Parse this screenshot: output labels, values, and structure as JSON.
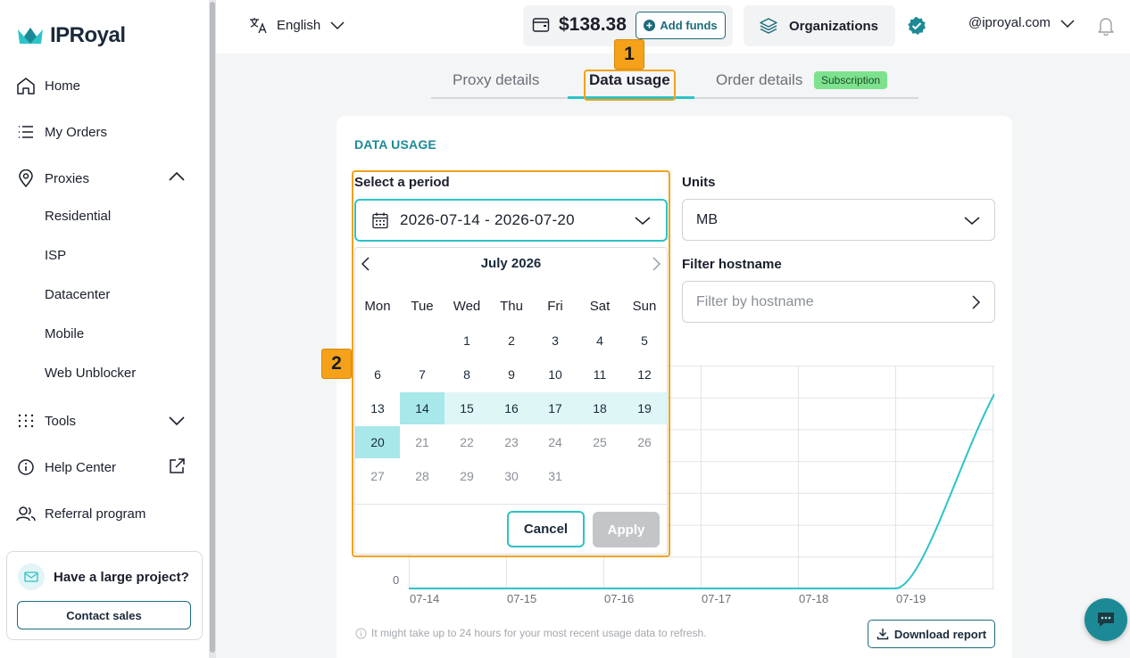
{
  "brand": {
    "name": "IPRoyal",
    "accent": "#2cc3c7",
    "dark_accent": "#1c6b7a"
  },
  "sidebar": {
    "items": [
      {
        "label": "Home",
        "icon": "home-icon"
      },
      {
        "label": "My Orders",
        "icon": "list-icon"
      },
      {
        "label": "Proxies",
        "icon": "location-pin-icon"
      },
      {
        "label": "Tools",
        "icon": "grid-dots-icon"
      },
      {
        "label": "Help Center",
        "icon": "info-icon"
      },
      {
        "label": "Referral program",
        "icon": "users-icon"
      }
    ],
    "proxies_sub": [
      "Residential",
      "ISP",
      "Datacenter",
      "Mobile",
      "Web Unblocker"
    ],
    "promo": {
      "title": "Have a large project?",
      "button": "Contact sales"
    }
  },
  "topbar": {
    "language": "English",
    "balance": "$138.38",
    "add_funds": "Add funds",
    "organizations": "Organizations",
    "account": "@iproyal.com"
  },
  "tabs": [
    {
      "label": "Proxy details",
      "active": false
    },
    {
      "label": "Data usage",
      "active": true
    },
    {
      "label": "Order details",
      "active": false,
      "badge": "Subscription"
    }
  ],
  "data_usage": {
    "title": "DATA USAGE",
    "period_label": "Select a period",
    "period_value": "2026-07-14 - 2026-07-20",
    "units_label": "Units",
    "units_value": "MB",
    "filter_label": "Filter hostname",
    "filter_placeholder": "Filter by hostname",
    "note": "It might take up to 24 hours for your most recent usage data to refresh.",
    "download": "Download report"
  },
  "calendar": {
    "month": "July 2026",
    "weekdays": [
      "Mon",
      "Tue",
      "Wed",
      "Thu",
      "Fri",
      "Sat",
      "Sun"
    ],
    "weeks": [
      [
        "",
        "",
        "1",
        "2",
        "3",
        "4",
        "5"
      ],
      [
        "6",
        "7",
        "8",
        "9",
        "10",
        "11",
        "12"
      ],
      [
        "13",
        "14",
        "15",
        "16",
        "17",
        "18",
        "19"
      ],
      [
        "20",
        "21",
        "22",
        "23",
        "24",
        "25",
        "26"
      ],
      [
        "27",
        "28",
        "29",
        "30",
        "31",
        "",
        ""
      ]
    ],
    "selected_start": "14",
    "selected_end": "20",
    "cancel": "Cancel",
    "apply": "Apply"
  },
  "chart_data": {
    "type": "line",
    "x": [
      "07-14",
      "07-15",
      "07-16",
      "07-17",
      "07-18",
      "07-19"
    ],
    "y_tick_visible": "0",
    "series": [
      {
        "values": [
          0,
          0,
          0,
          0,
          0,
          0
        ]
      }
    ],
    "notes": "line stays at 0 until 07-19 then rises steeply toward the right edge",
    "color": "#2cc3c7"
  },
  "annotations": {
    "marker1": "1",
    "marker2": "2",
    "color": "#f3a21b"
  }
}
